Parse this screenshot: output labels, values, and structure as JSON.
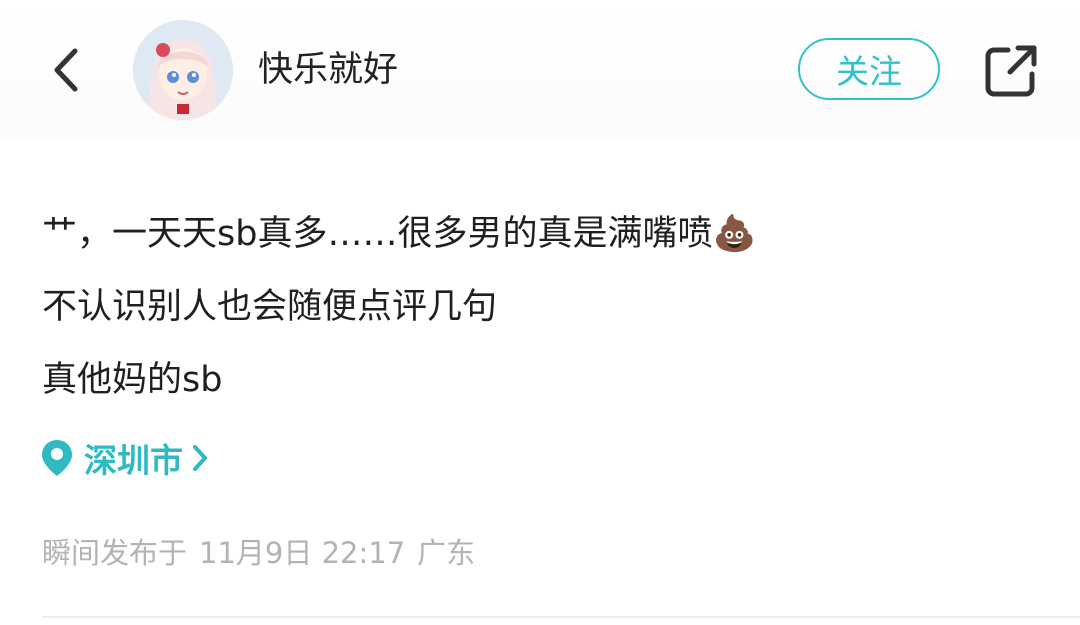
{
  "header": {
    "username": "快乐就好",
    "follow_label": "关注"
  },
  "post": {
    "line1": "艹，一天天sb真多……很多男的真是满嘴喷",
    "line1_emoji": "💩",
    "line2": "不认识别人也会随便点评几句",
    "line3": "真他妈的sb"
  },
  "location": {
    "label": "深圳市"
  },
  "meta": {
    "publish_prefix": "瞬间发布于",
    "datetime": "11月9日 22:17",
    "region": "广东"
  },
  "colors": {
    "accent": "#32c1c9",
    "text": "#1f1f1f",
    "muted": "#b3b3b3"
  },
  "icons": {
    "back": "chevron-left-icon",
    "share": "share-external-icon",
    "location": "location-pin-icon",
    "location_more": "chevron-right-icon"
  }
}
